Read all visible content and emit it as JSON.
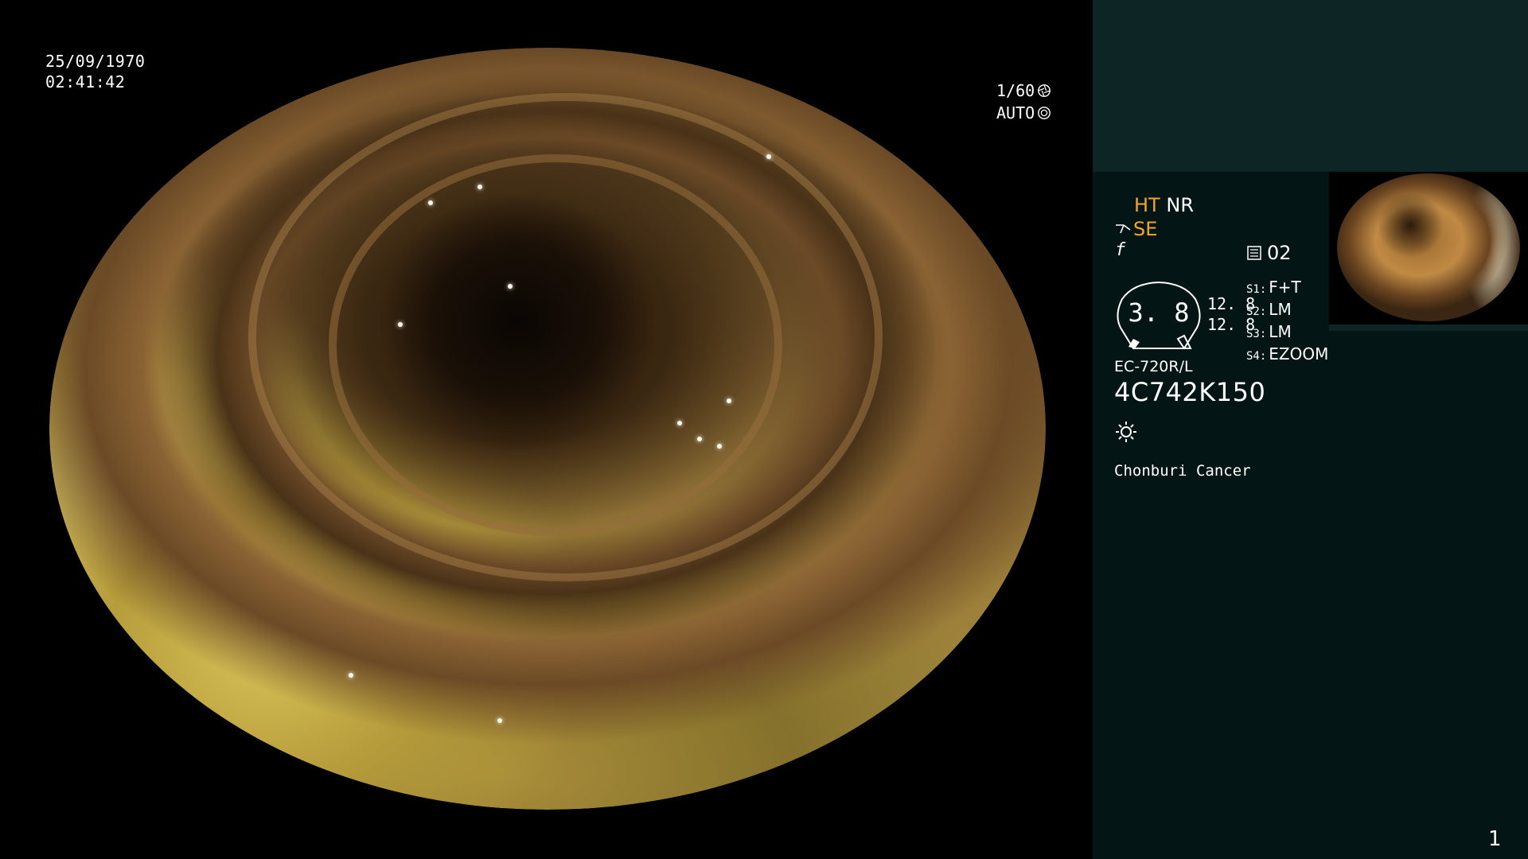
{
  "overlay": {
    "date": "25/09/1970",
    "time": "02:41:42",
    "shutter_speed": "1/60",
    "exposure_mode": "AUTO"
  },
  "panel": {
    "mode_ht": "HT",
    "mode_nr": "NR",
    "mode_se": "SE",
    "f_symbol": "f",
    "memory_number": "02",
    "gauge_value": "3. 8",
    "gauge_readings": [
      "12. 8",
      "12. 8"
    ],
    "switches": [
      {
        "key": "S1:",
        "value": "F+T"
      },
      {
        "key": "S2:",
        "value": "LM"
      },
      {
        "key": "S3:",
        "value": "LM"
      },
      {
        "key": "S4:",
        "value": "EZOOM"
      }
    ],
    "scope_model": "EC-720R/L",
    "scope_serial": "4C742K150",
    "note": "Chonburi Cancer",
    "page_number": "1"
  },
  "icons": {
    "shutter": "aperture-icon",
    "auto": "iris-icon",
    "scope_se": "scope-icon",
    "memory": "memory-icon",
    "light": "sun-icon"
  },
  "colors": {
    "accent_orange": "#f5a623",
    "panel_bg": "#041515",
    "panel_top_bg": "#0d2525"
  }
}
